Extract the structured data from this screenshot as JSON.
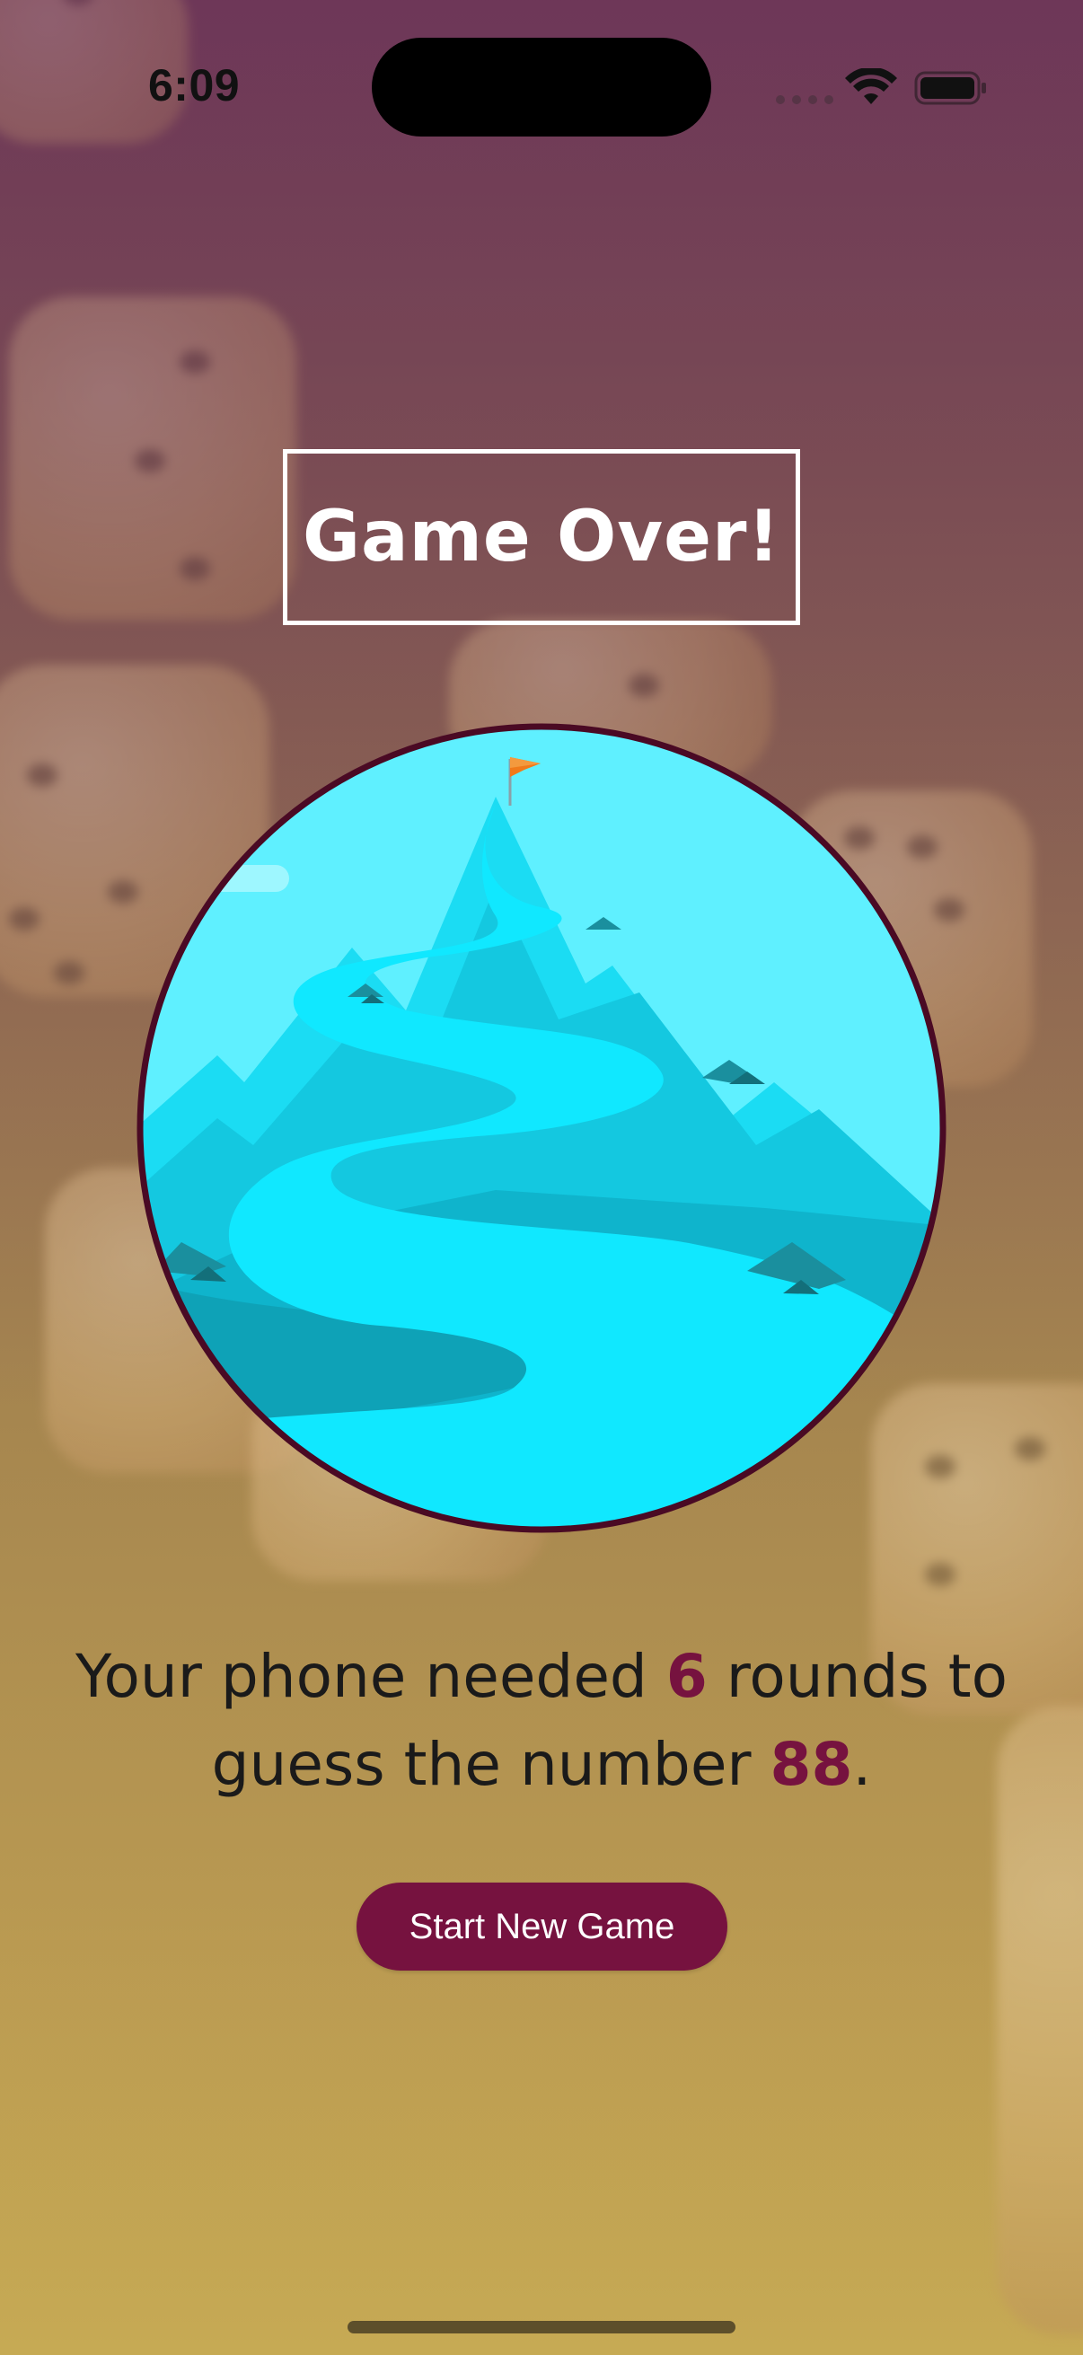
{
  "status_bar": {
    "time": "6:09",
    "wifi_icon": "wifi-icon",
    "battery_icon": "battery-icon",
    "signal_icon": "cellular-signal-icon"
  },
  "screen": {
    "title": "Game Over!",
    "illustration": "mountain-summit-flag-illustration",
    "summary": {
      "prefix": "Your phone needed ",
      "rounds": "6",
      "middle": " rounds to guess the number ",
      "number": "88",
      "suffix": "."
    },
    "button_label": "Start New Game"
  },
  "colors": {
    "accent": "#76123f",
    "title_border": "#ffffff",
    "circle_border": "#4a0a24",
    "sky": "#5ff0ff",
    "water": "#10e8ff"
  }
}
